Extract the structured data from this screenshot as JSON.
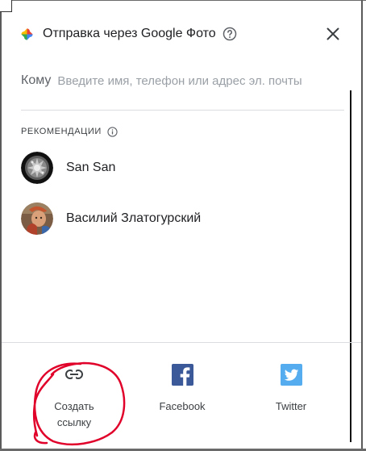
{
  "dialog": {
    "title": "Отправка через Google Фото",
    "to_label": "Кому",
    "to_placeholder": "Введите имя, телефон или адрес эл. почты"
  },
  "recommendations": {
    "label": "РЕКОМЕНДАЦИИ",
    "contacts": [
      {
        "name": "San San"
      },
      {
        "name": "Василий Златогурский"
      }
    ]
  },
  "share_options": {
    "link": {
      "label": "Создать ссылку",
      "icon": "link-icon"
    },
    "facebook": {
      "label": "Facebook",
      "icon": "facebook-icon"
    },
    "twitter": {
      "label": "Twitter",
      "icon": "twitter-icon"
    }
  },
  "colors": {
    "facebook": "#3b5998",
    "twitter": "#55acee",
    "annotation": "#e0002a"
  }
}
